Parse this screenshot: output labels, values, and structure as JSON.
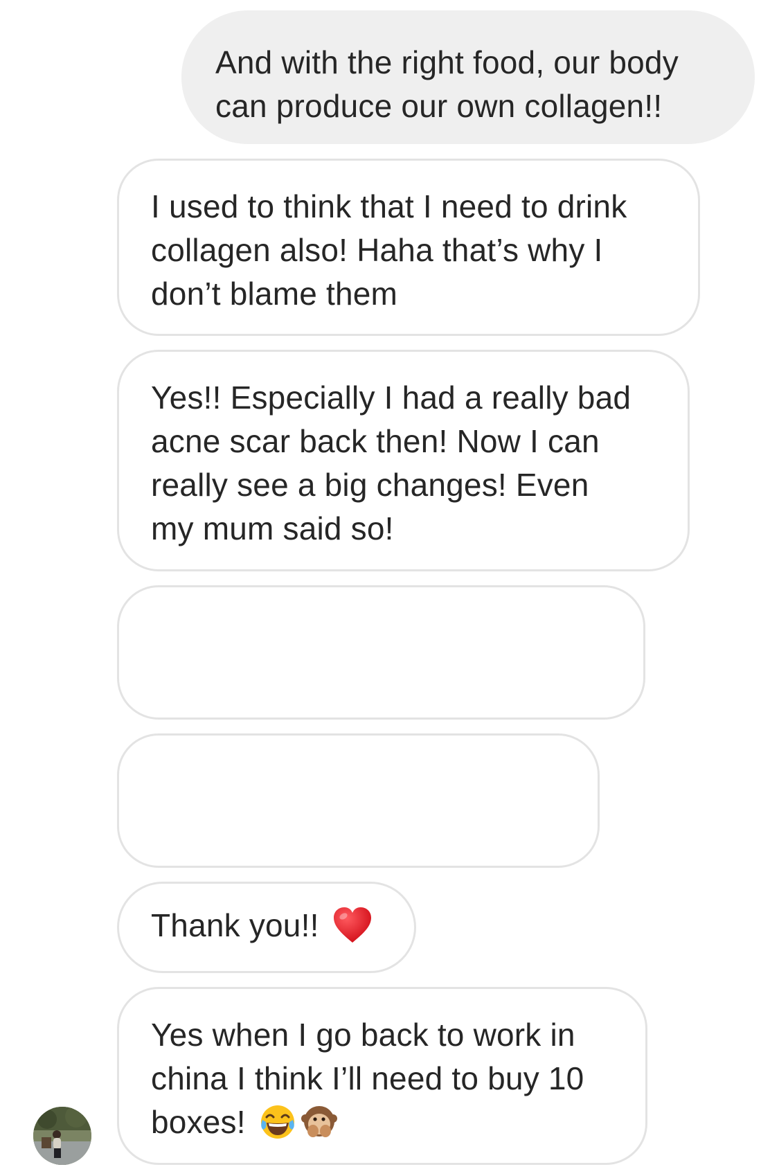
{
  "conversation": {
    "messages": [
      {
        "id": "msg-0",
        "direction": "outgoing",
        "lines": [
          "And with the right food, our body",
          "can produce our own collagen!!"
        ]
      },
      {
        "id": "msg-1",
        "direction": "incoming",
        "lines": [
          "I used to think that I need to drink",
          "collagen also! Haha that’s why I",
          "don’t blame them"
        ]
      },
      {
        "id": "msg-2",
        "direction": "incoming",
        "lines": [
          "Yes!! Especially I had a really bad",
          "acne scar back then! Now I can",
          "really see a big changes! Even",
          "my mum said so!"
        ]
      },
      {
        "id": "msg-3",
        "direction": "incoming",
        "lines": []
      },
      {
        "id": "msg-4",
        "direction": "incoming",
        "lines": []
      },
      {
        "id": "msg-5",
        "direction": "incoming",
        "text": "Thank you!!",
        "emojis": [
          "red-heart"
        ]
      },
      {
        "id": "msg-6",
        "direction": "incoming",
        "lines": [
          "Yes when I go back to work in",
          "china I think I’ll need to buy 10"
        ],
        "last_line": "boxes!",
        "emojis": [
          "face-with-tears-of-joy",
          "speak-no-evil-monkey"
        ]
      }
    ],
    "sender_avatar": "profile-photo"
  },
  "colors": {
    "outgoing_bubble": "#efefef",
    "incoming_border": "#e3e3e3",
    "text": "#262626",
    "heart": "#e0242f"
  }
}
